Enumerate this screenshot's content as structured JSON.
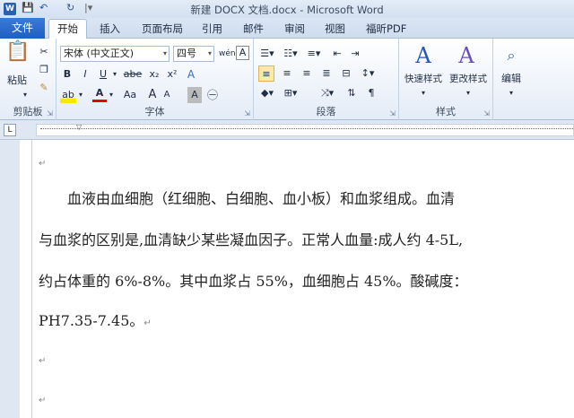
{
  "window": {
    "title": "新建 DOCX 文档.docx - Microsoft Word"
  },
  "quick_access": {
    "app_icon": "W",
    "save": "save-icon",
    "undo": "↶",
    "redo": "↻"
  },
  "tabs": {
    "file": "文件",
    "home": "开始",
    "insert": "插入",
    "layout": "页面布局",
    "references": "引用",
    "mailings": "邮件",
    "review": "审阅",
    "view": "视图",
    "pdf": "福昕PDF"
  },
  "ribbon": {
    "clipboard": {
      "label": "剪贴板",
      "paste": "粘贴"
    },
    "font": {
      "label": "字体",
      "font_name": "宋体 (中文正文)",
      "font_size": "四号",
      "bold": "B",
      "italic": "I",
      "underline": "U",
      "strike": "abe",
      "sub": "x₂",
      "sup": "x²",
      "font_color": "A",
      "change_case": "Aa",
      "grow": "A",
      "shrink": "A",
      "clear": "A"
    },
    "paragraph": {
      "label": "段落"
    },
    "styles": {
      "label": "样式",
      "quick": "快速样式",
      "change": "更改样式"
    },
    "editing": {
      "label": "编辑"
    }
  },
  "document": {
    "lines": [
      "",
      "　　血液由血细胞（红细胞、白细胞、血小板）和血浆组成。血清",
      "与血浆的区别是,血清缺少某些凝血因子。正常人血量:成人约 4-5L,",
      "约占体重的 6%-8%。其中血浆占 55%，血细胞占 45%。酸碱度：",
      "PH7.35-7.45。",
      "",
      ""
    ],
    "para_mark": "↵"
  }
}
